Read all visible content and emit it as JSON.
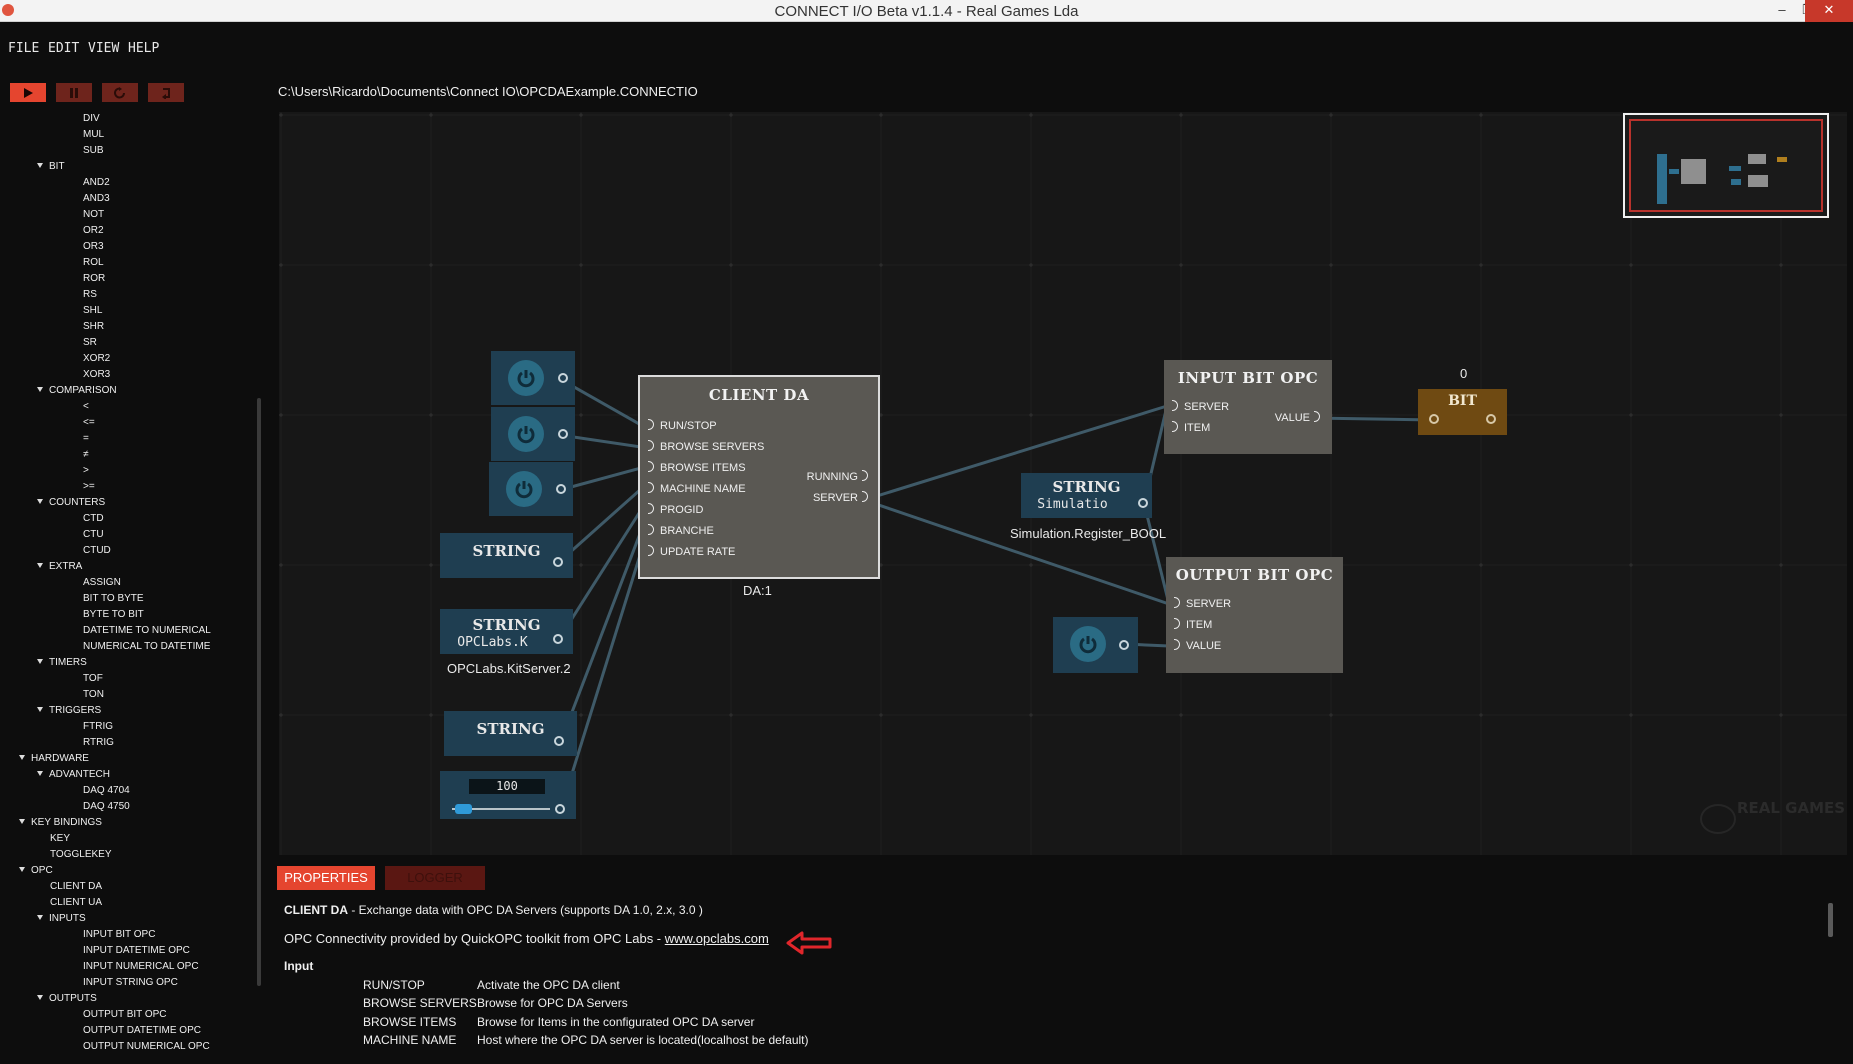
{
  "window": {
    "title": "CONNECT I/O Beta v1.1.4 - Real Games Lda",
    "minimize": "–",
    "restore": "❐",
    "close": "✕"
  },
  "menu": [
    "FILE",
    "EDIT",
    "VIEW",
    "HELP"
  ],
  "toolbar": {
    "play_icon": "play-icon",
    "pause_icon": "pause-icon",
    "reset_icon": "reset-icon",
    "step_icon": "step-icon"
  },
  "file_path": "C:\\Users\\Ricardo\\Documents\\Connect IO\\OPCDAExample.CONNECTIO",
  "sidebar": {
    "items": [
      {
        "label": "DIV",
        "level": 3
      },
      {
        "label": "MUL",
        "level": 3
      },
      {
        "label": "SUB",
        "level": 3
      },
      {
        "label": "BIT",
        "level": 2,
        "expanded": true
      },
      {
        "label": "AND2",
        "level": 3
      },
      {
        "label": "AND3",
        "level": 3
      },
      {
        "label": "NOT",
        "level": 3
      },
      {
        "label": "OR2",
        "level": 3
      },
      {
        "label": "OR3",
        "level": 3
      },
      {
        "label": "ROL",
        "level": 3
      },
      {
        "label": "ROR",
        "level": 3
      },
      {
        "label": "RS",
        "level": 3
      },
      {
        "label": "SHL",
        "level": 3
      },
      {
        "label": "SHR",
        "level": 3
      },
      {
        "label": "SR",
        "level": 3
      },
      {
        "label": "XOR2",
        "level": 3
      },
      {
        "label": "XOR3",
        "level": 3
      },
      {
        "label": "COMPARISON",
        "level": 2,
        "expanded": true
      },
      {
        "label": "<",
        "level": 3
      },
      {
        "label": "<=",
        "level": 3
      },
      {
        "label": "=",
        "level": 3
      },
      {
        "label": "≠",
        "level": 3
      },
      {
        "label": ">",
        "level": 3
      },
      {
        "label": ">=",
        "level": 3
      },
      {
        "label": "COUNTERS",
        "level": 2,
        "expanded": true
      },
      {
        "label": "CTD",
        "level": 3
      },
      {
        "label": "CTU",
        "level": 3
      },
      {
        "label": "CTUD",
        "level": 3
      },
      {
        "label": "EXTRA",
        "level": 2,
        "expanded": true
      },
      {
        "label": "ASSIGN",
        "level": 3
      },
      {
        "label": "BIT TO BYTE",
        "level": 3
      },
      {
        "label": "BYTE TO BIT",
        "level": 3
      },
      {
        "label": "DATETIME TO NUMERICAL",
        "level": 3
      },
      {
        "label": "NUMERICAL TO DATETIME",
        "level": 3
      },
      {
        "label": "TIMERS",
        "level": 2,
        "expanded": true
      },
      {
        "label": "TOF",
        "level": 3
      },
      {
        "label": "TON",
        "level": 3
      },
      {
        "label": "TRIGGERS",
        "level": 2,
        "expanded": true
      },
      {
        "label": "FTRIG",
        "level": 3
      },
      {
        "label": "RTRIG",
        "level": 3
      },
      {
        "label": "HARDWARE",
        "level": 1,
        "expanded": true
      },
      {
        "label": "ADVANTECH",
        "level": 2,
        "expanded": true
      },
      {
        "label": "DAQ 4704",
        "level": 3
      },
      {
        "label": "DAQ 4750",
        "level": 3
      },
      {
        "label": "KEY BINDINGS",
        "level": 1,
        "expanded": true
      },
      {
        "label": "KEY",
        "level": 2
      },
      {
        "label": "TOGGLEKEY",
        "level": 2
      },
      {
        "label": "OPC",
        "level": 1,
        "expanded": true
      },
      {
        "label": "CLIENT DA",
        "level": 2
      },
      {
        "label": "CLIENT UA",
        "level": 2
      },
      {
        "label": "INPUTS",
        "level": 2,
        "expanded": true
      },
      {
        "label": "INPUT BIT OPC",
        "level": 3
      },
      {
        "label": "INPUT DATETIME OPC",
        "level": 3
      },
      {
        "label": "INPUT NUMERICAL OPC",
        "level": 3
      },
      {
        "label": "INPUT STRING OPC",
        "level": 3
      },
      {
        "label": "OUTPUTS",
        "level": 2,
        "expanded": true
      },
      {
        "label": "OUTPUT BIT OPC",
        "level": 3
      },
      {
        "label": "OUTPUT DATETIME OPC",
        "level": 3
      },
      {
        "label": "OUTPUT NUMERICAL OPC",
        "level": 3
      }
    ]
  },
  "nodes": {
    "string1": {
      "title": "STRING"
    },
    "string2": {
      "title": "STRING",
      "value": "OPCLabs.K",
      "caption": "OPCLabs.KitServer.2"
    },
    "string3": {
      "title": "STRING"
    },
    "string4": {
      "title": "STRING",
      "value": "Simulatio",
      "caption": "Simulation.Register_BOOL"
    },
    "slider": {
      "value": "100",
      "level": 0.05
    },
    "client_da": {
      "title": "CLIENT DA",
      "inputs": [
        "RUN/STOP",
        "BROWSE SERVERS",
        "BROWSE ITEMS",
        "MACHINE NAME",
        "PROGID",
        "BRANCHE",
        "UPDATE RATE"
      ],
      "outputs": [
        "RUNNING",
        "SERVER"
      ],
      "caption": "DA:1"
    },
    "input_bit_opc": {
      "title": "INPUT BIT OPC",
      "inputs": [
        "SERVER",
        "ITEM"
      ],
      "outputs": [
        "VALUE"
      ]
    },
    "output_bit_opc": {
      "title": "OUTPUT BIT OPC",
      "inputs": [
        "SERVER",
        "ITEM",
        "VALUE"
      ]
    },
    "bit": {
      "title": "BIT",
      "value_label": "0"
    }
  },
  "watermark": "REAL GAMES",
  "tabs": {
    "properties": "PROPERTIES",
    "logger": "LOGGER"
  },
  "properties": {
    "heading_name": "CLIENT DA",
    "heading_desc": " - Exchange data with OPC DA Servers (supports DA 1.0, 2.x, 3.0 )",
    "provided_text": "OPC Connectivity provided by QuickOPC toolkit from OPC Labs - ",
    "link": "www.opclabs.com",
    "input_header": "Input",
    "rows": [
      {
        "name": "RUN/STOP",
        "desc": "Activate the OPC DA client"
      },
      {
        "name": "BROWSE SERVERS",
        "desc": "Browse for OPC DA Servers"
      },
      {
        "name": "BROWSE ITEMS",
        "desc": "Browse for Items in the configurated OPC DA server"
      },
      {
        "name": "MACHINE NAME",
        "desc": "Host where  the OPC DA server is located(localhost be default)"
      }
    ]
  },
  "colors": {
    "accent": "#e5452f",
    "node_blue": "#1f3e51",
    "node_gray": "#5a5853",
    "node_bit": "#6f4a12",
    "annotation_arrow": "#e0262b"
  }
}
